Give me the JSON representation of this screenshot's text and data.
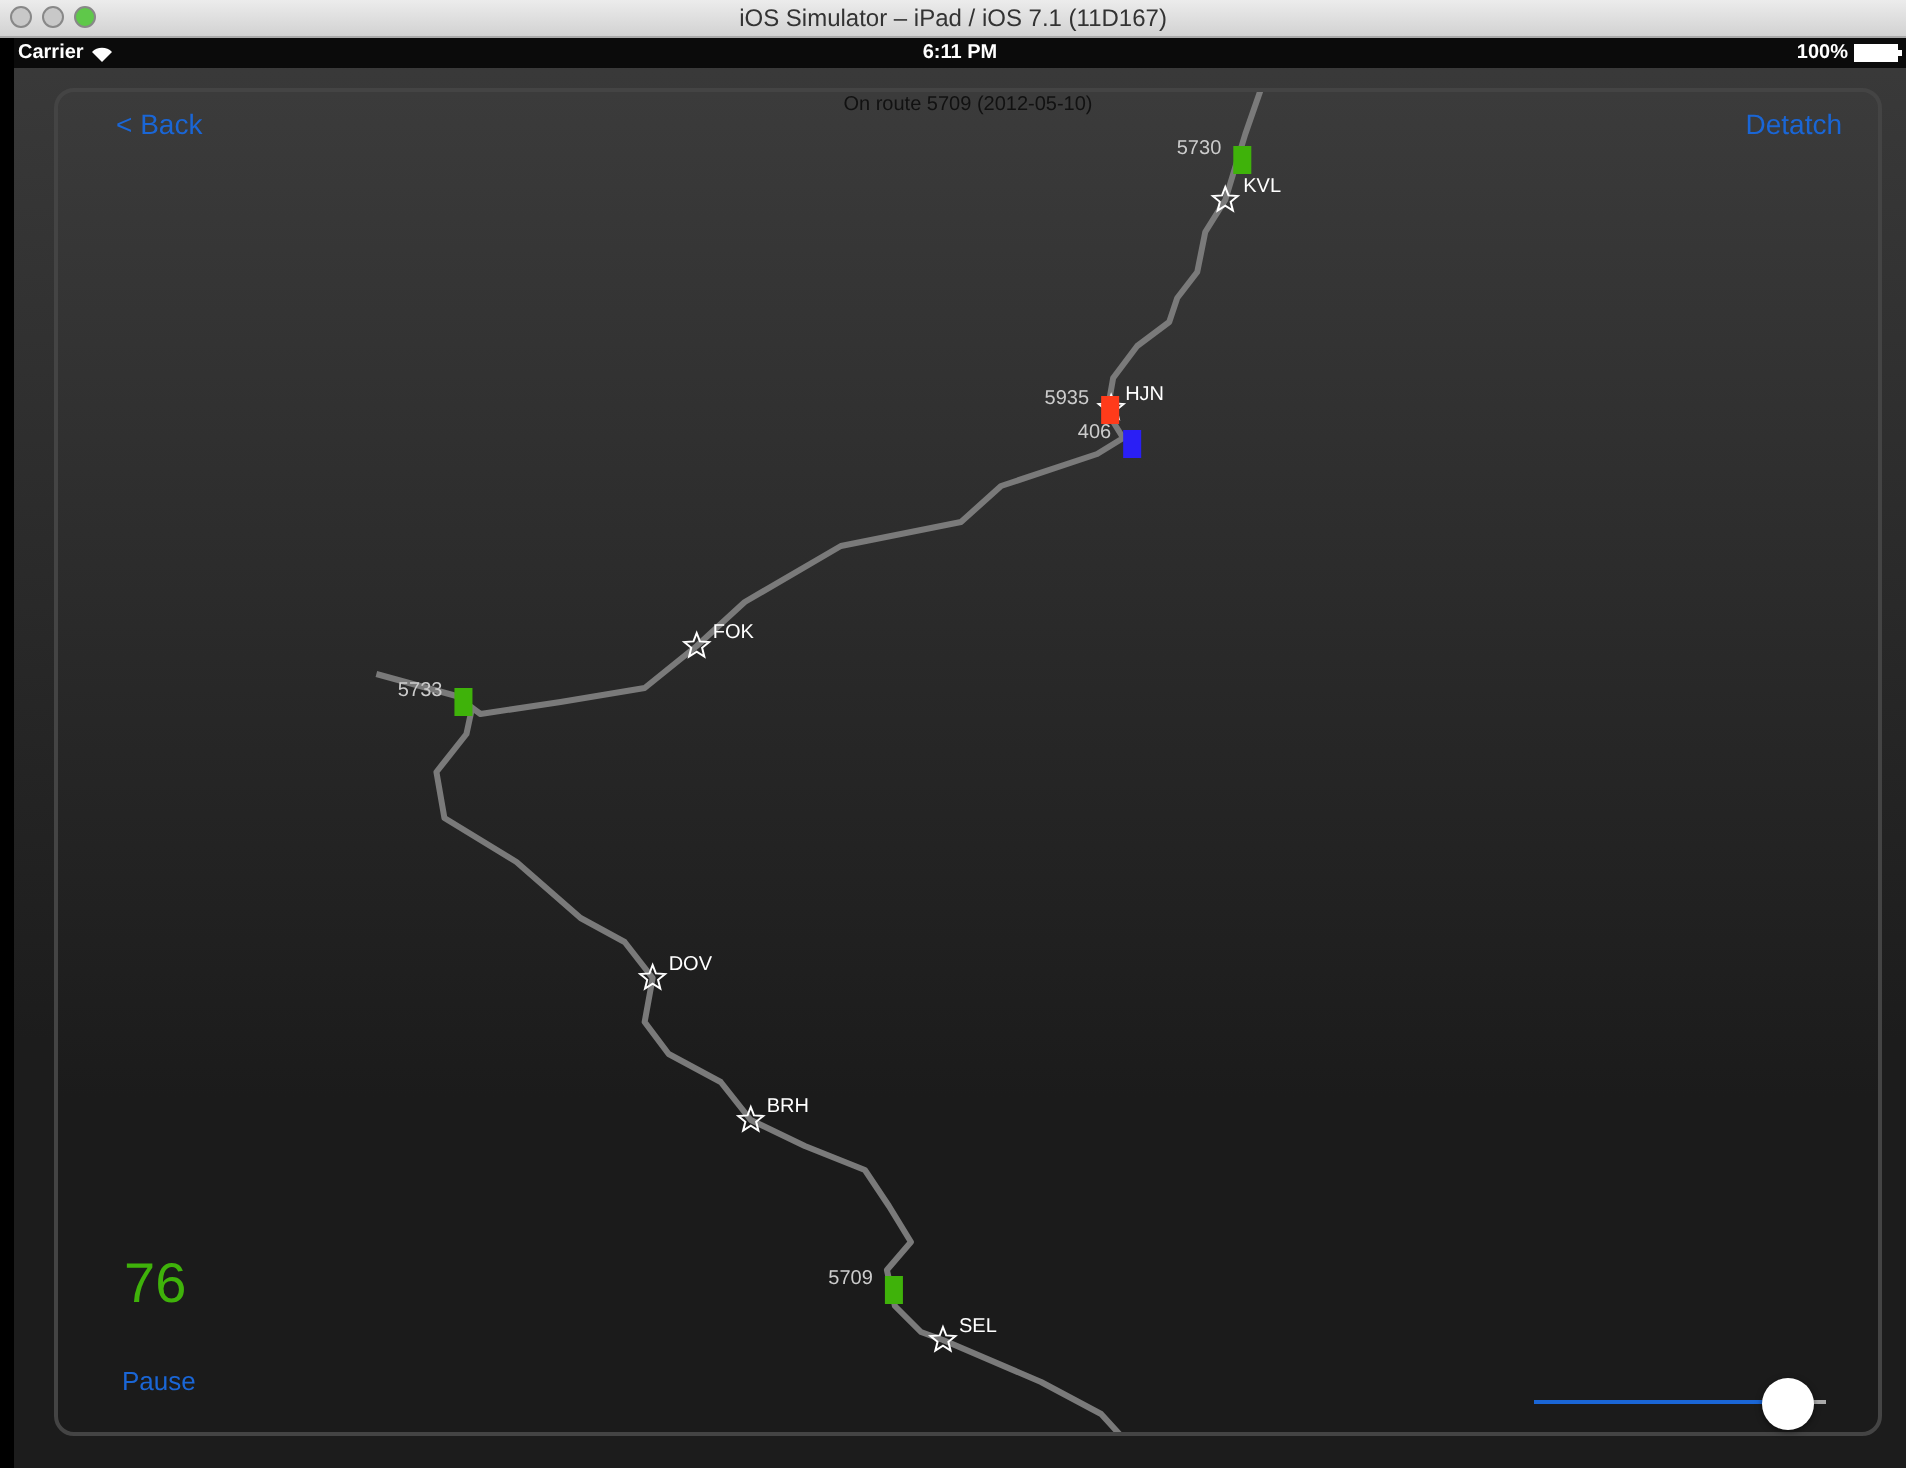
{
  "window": {
    "title": "iOS Simulator – iPad / iOS 7.1 (11D167)"
  },
  "status_bar": {
    "carrier": "Carrier",
    "time": "6:11 PM",
    "battery": "100%"
  },
  "header": {
    "back": "< Back",
    "subtitle": "On route 5709 (2012-05-10)",
    "detach": "Detatch"
  },
  "stations": [
    {
      "name": "KVL"
    },
    {
      "name": "HJN"
    },
    {
      "name": "FOK"
    },
    {
      "name": "DOV"
    },
    {
      "name": "BRH"
    },
    {
      "name": "SEL"
    }
  ],
  "trains": [
    {
      "number": "5730",
      "color": "#3fb20a"
    },
    {
      "number": "5935",
      "color": "#ff3b1a"
    },
    {
      "number": "406",
      "color": "#2a1ff5"
    },
    {
      "number": "5733",
      "color": "#3fb20a"
    },
    {
      "number": "5709",
      "color": "#3fb20a"
    }
  ],
  "counter": "76",
  "pause": "Pause",
  "slider": {
    "level": 0.87
  }
}
